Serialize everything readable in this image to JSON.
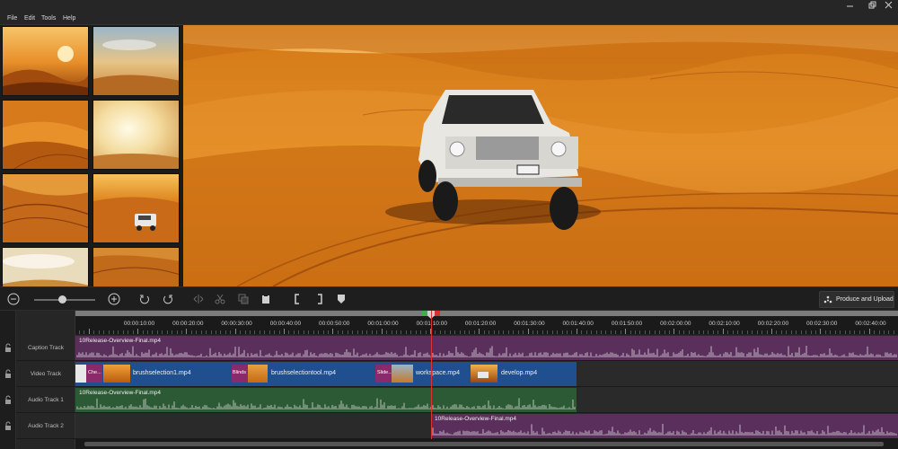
{
  "menu": [
    "File",
    "Edit",
    "Tools",
    "Help"
  ],
  "window_controls": [
    "minimize-icon",
    "restore-icon",
    "close-icon"
  ],
  "thumbnails": [
    {
      "name": "thumb-sunset-dunes",
      "sky": "#f0a43a"
    },
    {
      "name": "thumb-clouds-dunes",
      "sky": "#e9c48a"
    },
    {
      "name": "thumb-orange-dunes",
      "sky": "#d97c1e"
    },
    {
      "name": "thumb-sun-haze",
      "sky": "#f3dca0"
    },
    {
      "name": "thumb-tracks-dunes",
      "sky": "#c86f1a"
    },
    {
      "name": "thumb-jeep-dunes",
      "sky": "#f2b24a"
    },
    {
      "name": "thumb-pale-sky",
      "sky": "#f1e2bc"
    },
    {
      "name": "thumb-ridge-dunes",
      "sky": "#d68a32"
    }
  ],
  "toolbar": {
    "icons": [
      "zoom-out-icon",
      "zoom-in-icon",
      "undo-icon",
      "redo-icon",
      "split-icon",
      "cut-icon",
      "copy-icon",
      "paste-icon",
      "mark-in-icon",
      "mark-out-icon",
      "marker-icon"
    ],
    "zoom_level": 0.45,
    "produce_label": "Produce and Upload"
  },
  "timeline": {
    "ruler_labels": [
      "00:00:10:00",
      "00:00:20:00",
      "00:00:30:00",
      "00:00:40:00",
      "00:00:50:00",
      "00:01:00:00",
      "00:01:10:00",
      "00:01:20:00",
      "00:01:30:00",
      "00:01:40:00",
      "00:01:50:00",
      "00:02:00:00",
      "00:02:10:00",
      "00:02:20:00",
      "00:02:30:00",
      "00:02:40:00"
    ],
    "tracks": [
      {
        "label": "Caption Track"
      },
      {
        "label": "Video Track"
      },
      {
        "label": "Audio Track 1"
      },
      {
        "label": "Audio Track 2"
      }
    ],
    "caption_clip": "10Release-Overview-Final.mp4",
    "video_clips": [
      {
        "transition": "Che...",
        "name": "brushselection1.mp4"
      },
      {
        "transition": "Blinds",
        "name": "brushselectiontool.mp4"
      },
      {
        "transition": "Slide...",
        "name": "workspace.mp4"
      },
      {
        "transition": "",
        "name": "develop.mp4"
      }
    ],
    "audio1_clip": "10Release-Overview-Final.mp4",
    "audio2_clip": "10Release-Overview-Final.mp4",
    "colors": {
      "caption": "#5a2f5c",
      "video": "#1f4f8f",
      "audio1": "#2c5a34",
      "audio2": "#5a2f5c",
      "playhead": "#e03030"
    }
  }
}
